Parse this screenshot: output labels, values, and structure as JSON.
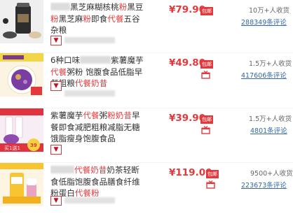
{
  "products": [
    {
      "title_blur_lead": "",
      "title_segments": [
        {
          "t": "黑芝麻糊核桃"
        },
        {
          "t": "粉",
          "hl": true
        },
        {
          "t": "黑豆"
        },
        {
          "t": "粉",
          "hl": true
        },
        {
          "t": "黑芝麻"
        },
        {
          "t": "粉",
          "hl": true
        },
        {
          "t": "即食"
        },
        {
          "t": "代餐",
          "hl": true
        },
        {
          "t": "五谷杂粮"
        }
      ],
      "price": "¥79.90",
      "tag": "包邮",
      "sales": "10万+人收货",
      "reviews": "288349条评论",
      "accent": "#3a3a3a"
    },
    {
      "title_segments": [
        {
          "t": "6种口味"
        },
        {
          "blur": 44
        },
        {
          "t": "紫薯魔芋"
        },
        {
          "t": "代餐",
          "hl": true
        },
        {
          "t": "粥粉 饱腹食品低脂早餐粗粮"
        },
        {
          "t": "代餐奶昔",
          "hl": true
        }
      ],
      "price": "¥49.80",
      "tag": "包邮",
      "sales": "1.5万+人收货",
      "reviews": "417606条评论",
      "accent": "#f3d54a"
    },
    {
      "title_segments": [
        {
          "t": "紫薯魔芋"
        },
        {
          "t": "代餐",
          "hl": true
        },
        {
          "t": "粥"
        },
        {
          "t": "粉奶昔",
          "hl": true
        },
        {
          "t": "早餐即食减肥粗粮减脂无糖饿脂瘦身饱腹食品"
        }
      ],
      "price": "¥39.90",
      "tag": "包邮",
      "sales": "1.5万+人收货",
      "reviews": "4801条评论",
      "accent": "#e0323f",
      "badge": "买1送1",
      "badge_price": "39"
    },
    {
      "title_segments": [
        {
          "blur": 34
        },
        {
          "t": "代餐奶昔",
          "hl": true
        },
        {
          "t": "奶茶轻断食低脂饱腹食品膳食纤维粉蛋白"
        },
        {
          "t": "代餐粉",
          "hl": true
        }
      ],
      "price": "¥119.00",
      "tag": "包邮",
      "sales": "9500+人收货",
      "reviews": "223673条评论",
      "accent": "#f6c531"
    }
  ]
}
